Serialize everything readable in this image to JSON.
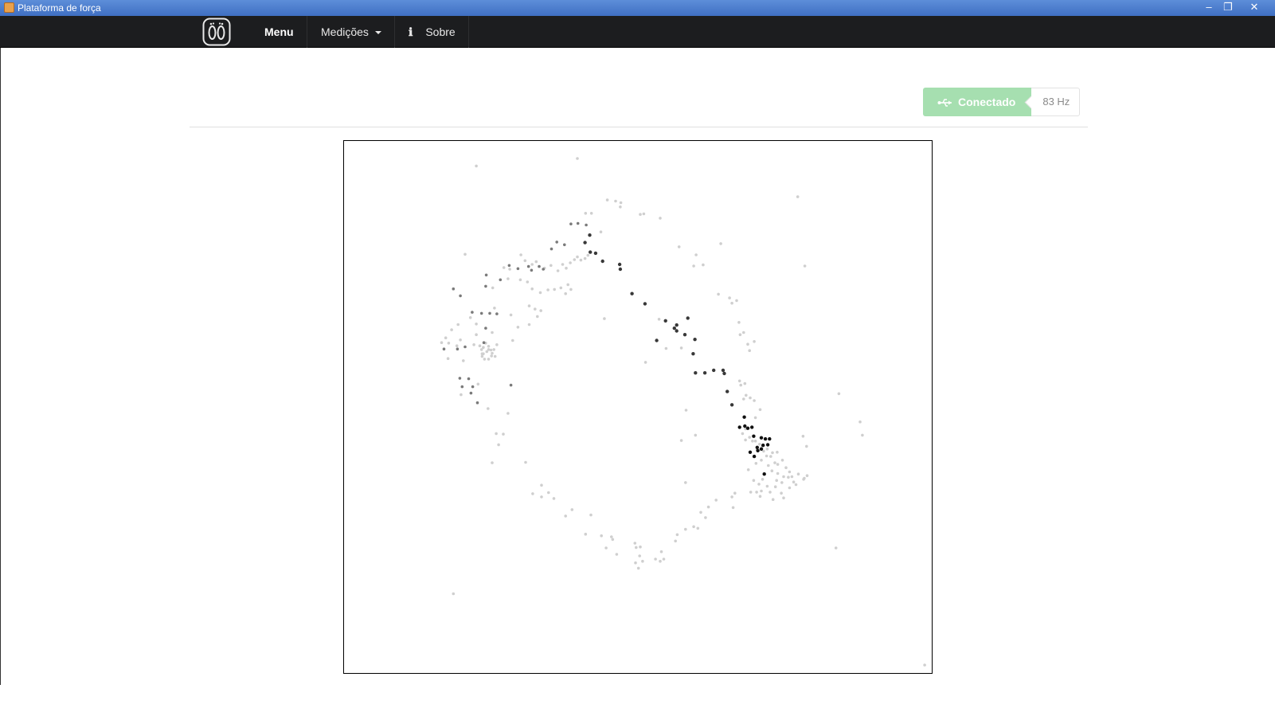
{
  "window": {
    "title": "Plataforma de força"
  },
  "navbar": {
    "menu_label": "Menu",
    "measurements_label": "Medições",
    "info_icon": "ℹ",
    "about_label": "Sobre"
  },
  "status": {
    "connected_label": "Conectado",
    "frequency": "83 Hz",
    "usb_icon": "usb-icon",
    "color": "#a6dfb0"
  },
  "chart_data": {
    "type": "scatter",
    "title": "",
    "xlabel": "",
    "ylabel": "",
    "xlim": [
      0,
      1
    ],
    "ylim": [
      0,
      1
    ],
    "grid": false,
    "series": [
      {
        "color": "#cfcfcf",
        "points": [
          [
            0.225,
            0.047
          ],
          [
            0.397,
            0.033
          ],
          [
            0.772,
            0.105
          ],
          [
            0.448,
            0.111
          ],
          [
            0.462,
            0.113
          ],
          [
            0.471,
            0.116
          ],
          [
            0.47,
            0.124
          ],
          [
            0.504,
            0.138
          ],
          [
            0.51,
            0.137
          ],
          [
            0.538,
            0.145
          ],
          [
            0.421,
            0.136
          ],
          [
            0.411,
            0.136
          ],
          [
            0.437,
            0.171
          ],
          [
            0.57,
            0.199
          ],
          [
            0.641,
            0.193
          ],
          [
            0.599,
            0.214
          ],
          [
            0.611,
            0.233
          ],
          [
            0.595,
            0.235
          ],
          [
            0.784,
            0.235
          ],
          [
            0.206,
            0.213
          ],
          [
            0.301,
            0.214
          ],
          [
            0.272,
            0.238
          ],
          [
            0.282,
            0.241
          ],
          [
            0.308,
            0.225
          ],
          [
            0.32,
            0.232
          ],
          [
            0.327,
            0.227
          ],
          [
            0.341,
            0.239
          ],
          [
            0.352,
            0.234
          ],
          [
            0.364,
            0.244
          ],
          [
            0.372,
            0.232
          ],
          [
            0.378,
            0.239
          ],
          [
            0.385,
            0.229
          ],
          [
            0.392,
            0.223
          ],
          [
            0.397,
            0.218
          ],
          [
            0.403,
            0.224
          ],
          [
            0.41,
            0.221
          ],
          [
            0.415,
            0.215
          ],
          [
            0.3,
            0.261
          ],
          [
            0.312,
            0.265
          ],
          [
            0.32,
            0.278
          ],
          [
            0.334,
            0.285
          ],
          [
            0.347,
            0.28
          ],
          [
            0.358,
            0.279
          ],
          [
            0.369,
            0.276
          ],
          [
            0.377,
            0.287
          ],
          [
            0.381,
            0.27
          ],
          [
            0.386,
            0.279
          ],
          [
            0.253,
            0.276
          ],
          [
            0.279,
            0.259
          ],
          [
            0.315,
            0.31
          ],
          [
            0.325,
            0.316
          ],
          [
            0.329,
            0.33
          ],
          [
            0.335,
            0.319
          ],
          [
            0.315,
            0.345
          ],
          [
            0.284,
            0.327
          ],
          [
            0.296,
            0.35
          ],
          [
            0.287,
            0.375
          ],
          [
            0.256,
            0.314
          ],
          [
            0.252,
            0.36
          ],
          [
            0.225,
            0.344
          ],
          [
            0.215,
            0.332
          ],
          [
            0.225,
            0.364
          ],
          [
            0.194,
            0.345
          ],
          [
            0.183,
            0.355
          ],
          [
            0.173,
            0.37
          ],
          [
            0.166,
            0.379
          ],
          [
            0.178,
            0.38
          ],
          [
            0.192,
            0.385
          ],
          [
            0.198,
            0.374
          ],
          [
            0.221,
            0.383
          ],
          [
            0.231,
            0.385
          ],
          [
            0.234,
            0.392
          ],
          [
            0.237,
            0.4
          ],
          [
            0.25,
            0.393
          ],
          [
            0.246,
            0.386
          ],
          [
            0.255,
            0.392
          ],
          [
            0.26,
            0.383
          ],
          [
            0.241,
            0.38
          ],
          [
            0.246,
            0.392
          ],
          [
            0.237,
            0.388
          ],
          [
            0.243,
            0.396
          ],
          [
            0.235,
            0.4
          ],
          [
            0.252,
            0.399
          ],
          [
            0.257,
            0.405
          ],
          [
            0.235,
            0.405
          ],
          [
            0.239,
            0.41
          ],
          [
            0.246,
            0.41
          ],
          [
            0.251,
            0.404
          ],
          [
            0.203,
            0.413
          ],
          [
            0.177,
            0.409
          ],
          [
            0.228,
            0.457
          ],
          [
            0.199,
            0.477
          ],
          [
            0.245,
            0.503
          ],
          [
            0.279,
            0.512
          ],
          [
            0.259,
            0.55
          ],
          [
            0.271,
            0.551
          ],
          [
            0.263,
            0.571
          ],
          [
            0.252,
            0.605
          ],
          [
            0.309,
            0.604
          ],
          [
            0.336,
            0.647
          ],
          [
            0.321,
            0.663
          ],
          [
            0.336,
            0.669
          ],
          [
            0.348,
            0.661
          ],
          [
            0.357,
            0.672
          ],
          [
            0.377,
            0.705
          ],
          [
            0.388,
            0.693
          ],
          [
            0.42,
            0.703
          ],
          [
            0.411,
            0.739
          ],
          [
            0.438,
            0.742
          ],
          [
            0.455,
            0.744
          ],
          [
            0.457,
            0.749
          ],
          [
            0.446,
            0.765
          ],
          [
            0.464,
            0.777
          ],
          [
            0.495,
            0.756
          ],
          [
            0.497,
            0.764
          ],
          [
            0.504,
            0.763
          ],
          [
            0.503,
            0.78
          ],
          [
            0.508,
            0.79
          ],
          [
            0.496,
            0.793
          ],
          [
            0.501,
            0.803
          ],
          [
            0.53,
            0.786
          ],
          [
            0.538,
            0.79
          ],
          [
            0.544,
            0.786
          ],
          [
            0.54,
            0.772
          ],
          [
            0.564,
            0.752
          ],
          [
            0.567,
            0.74
          ],
          [
            0.595,
            0.725
          ],
          [
            0.607,
            0.698
          ],
          [
            0.581,
            0.73
          ],
          [
            0.602,
            0.728
          ],
          [
            0.615,
            0.708
          ],
          [
            0.62,
            0.688
          ],
          [
            0.633,
            0.675
          ],
          [
            0.66,
            0.669
          ],
          [
            0.662,
            0.689
          ],
          [
            0.574,
            0.563
          ],
          [
            0.581,
            0.642
          ],
          [
            0.598,
            0.553
          ],
          [
            0.582,
            0.506
          ],
          [
            0.513,
            0.416
          ],
          [
            0.443,
            0.334
          ],
          [
            0.536,
            0.335
          ],
          [
            0.574,
            0.389
          ],
          [
            0.548,
            0.39
          ],
          [
            0.637,
            0.288
          ],
          [
            0.656,
            0.295
          ],
          [
            0.66,
            0.305
          ],
          [
            0.668,
            0.3
          ],
          [
            0.672,
            0.341
          ],
          [
            0.674,
            0.364
          ],
          [
            0.68,
            0.36
          ],
          [
            0.687,
            0.382
          ],
          [
            0.69,
            0.394
          ],
          [
            0.698,
            0.377
          ],
          [
            0.673,
            0.451
          ],
          [
            0.68,
            0.485
          ],
          [
            0.684,
            0.478
          ],
          [
            0.675,
            0.459
          ],
          [
            0.682,
            0.456
          ],
          [
            0.691,
            0.483
          ],
          [
            0.698,
            0.488
          ],
          [
            0.708,
            0.505
          ],
          [
            0.7,
            0.52
          ],
          [
            0.683,
            0.541
          ],
          [
            0.678,
            0.55
          ],
          [
            0.683,
            0.562
          ],
          [
            0.69,
            0.557
          ],
          [
            0.695,
            0.564
          ],
          [
            0.7,
            0.564
          ],
          [
            0.707,
            0.57
          ],
          [
            0.711,
            0.576
          ],
          [
            0.703,
            0.58
          ],
          [
            0.714,
            0.583
          ],
          [
            0.72,
            0.579
          ],
          [
            0.729,
            0.586
          ],
          [
            0.719,
            0.592
          ],
          [
            0.726,
            0.593
          ],
          [
            0.737,
            0.585
          ],
          [
            0.733,
            0.605
          ],
          [
            0.71,
            0.6
          ],
          [
            0.701,
            0.606
          ],
          [
            0.722,
            0.61
          ],
          [
            0.728,
            0.62
          ],
          [
            0.738,
            0.625
          ],
          [
            0.748,
            0.631
          ],
          [
            0.736,
            0.638
          ],
          [
            0.745,
            0.642
          ],
          [
            0.734,
            0.65
          ],
          [
            0.748,
            0.671
          ],
          [
            0.756,
            0.632
          ],
          [
            0.762,
            0.631
          ],
          [
            0.773,
            0.626
          ],
          [
            0.782,
            0.636
          ],
          [
            0.712,
            0.636
          ],
          [
            0.706,
            0.645
          ],
          [
            0.72,
            0.649
          ],
          [
            0.71,
            0.658
          ],
          [
            0.725,
            0.66
          ],
          [
            0.73,
            0.674
          ],
          [
            0.744,
            0.662
          ],
          [
            0.708,
            0.668
          ],
          [
            0.702,
            0.66
          ],
          [
            0.697,
            0.638
          ],
          [
            0.688,
            0.618
          ],
          [
            0.738,
            0.608
          ],
          [
            0.746,
            0.6
          ],
          [
            0.752,
            0.614
          ],
          [
            0.758,
            0.622
          ],
          [
            0.765,
            0.641
          ],
          [
            0.758,
            0.652
          ],
          [
            0.769,
            0.646
          ],
          [
            0.692,
            0.66
          ],
          [
            0.665,
            0.662
          ],
          [
            0.788,
            0.629
          ],
          [
            0.783,
            0.634
          ],
          [
            0.842,
            0.475
          ],
          [
            0.878,
            0.528
          ],
          [
            0.882,
            0.553
          ],
          [
            0.781,
            0.555
          ],
          [
            0.787,
            0.574
          ],
          [
            0.837,
            0.765
          ],
          [
            0.186,
            0.851
          ],
          [
            0.988,
            0.985
          ]
        ]
      },
      {
        "color": "#7a7a7a",
        "points": [
          [
            0.186,
            0.278
          ],
          [
            0.198,
            0.291
          ],
          [
            0.241,
            0.273
          ],
          [
            0.242,
            0.252
          ],
          [
            0.266,
            0.261
          ],
          [
            0.281,
            0.234
          ],
          [
            0.296,
            0.24
          ],
          [
            0.314,
            0.236
          ],
          [
            0.319,
            0.243
          ],
          [
            0.332,
            0.236
          ],
          [
            0.339,
            0.241
          ],
          [
            0.353,
            0.203
          ],
          [
            0.362,
            0.19
          ],
          [
            0.375,
            0.195
          ],
          [
            0.386,
            0.156
          ],
          [
            0.398,
            0.155
          ],
          [
            0.412,
            0.158
          ],
          [
            0.248,
            0.324
          ],
          [
            0.234,
            0.324
          ],
          [
            0.218,
            0.322
          ],
          [
            0.26,
            0.325
          ],
          [
            0.241,
            0.352
          ],
          [
            0.238,
            0.379
          ],
          [
            0.17,
            0.391
          ],
          [
            0.193,
            0.391
          ],
          [
            0.206,
            0.387
          ],
          [
            0.201,
            0.462
          ],
          [
            0.212,
            0.447
          ],
          [
            0.219,
            0.462
          ],
          [
            0.227,
            0.492
          ],
          [
            0.216,
            0.474
          ],
          [
            0.197,
            0.446
          ],
          [
            0.284,
            0.459
          ]
        ]
      },
      {
        "color": "#383838",
        "points": [
          [
            0.41,
            0.191
          ],
          [
            0.419,
            0.209
          ],
          [
            0.428,
            0.211
          ],
          [
            0.418,
            0.177
          ],
          [
            0.44,
            0.226
          ],
          [
            0.469,
            0.232
          ],
          [
            0.47,
            0.241
          ],
          [
            0.49,
            0.287
          ],
          [
            0.512,
            0.306
          ],
          [
            0.547,
            0.338
          ],
          [
            0.566,
            0.346
          ],
          [
            0.562,
            0.352
          ],
          [
            0.585,
            0.333
          ],
          [
            0.58,
            0.364
          ],
          [
            0.566,
            0.357
          ],
          [
            0.597,
            0.373
          ],
          [
            0.594,
            0.4
          ],
          [
            0.532,
            0.375
          ],
          [
            0.598,
            0.436
          ],
          [
            0.614,
            0.436
          ],
          [
            0.629,
            0.431
          ],
          [
            0.645,
            0.431
          ],
          [
            0.647,
            0.437
          ],
          [
            0.652,
            0.471
          ],
          [
            0.66,
            0.496
          ]
        ]
      },
      {
        "color": "#101010",
        "points": [
          [
            0.681,
            0.519
          ],
          [
            0.673,
            0.538
          ],
          [
            0.682,
            0.536
          ],
          [
            0.687,
            0.54
          ],
          [
            0.694,
            0.538
          ],
          [
            0.697,
            0.555
          ],
          [
            0.71,
            0.558
          ],
          [
            0.717,
            0.56
          ],
          [
            0.724,
            0.56
          ],
          [
            0.71,
            0.579
          ],
          [
            0.703,
            0.576
          ],
          [
            0.698,
            0.593
          ],
          [
            0.713,
            0.572
          ],
          [
            0.721,
            0.571
          ],
          [
            0.715,
            0.626
          ],
          [
            0.691,
            0.585
          ],
          [
            0.704,
            0.582
          ]
        ]
      }
    ]
  }
}
